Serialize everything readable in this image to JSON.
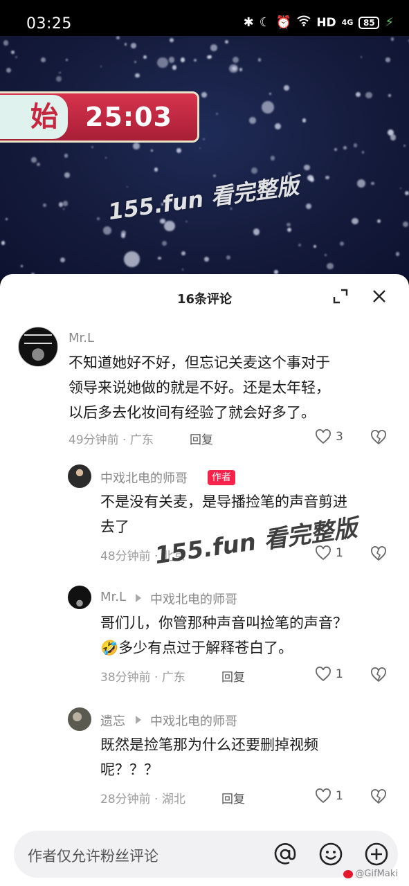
{
  "status_bar": {
    "time": "03:25",
    "bluetooth_icon": "bluetooth-icon",
    "dnd_icon": "moon-icon",
    "alarm_icon": "alarm-icon",
    "wifi_icon": "wifi-icon",
    "hd": "HD",
    "network": "4G",
    "battery": "85"
  },
  "video": {
    "banner_text": "始",
    "timer": "25:03",
    "watermark": "155.fun 看完整版"
  },
  "comments_panel": {
    "title": "16条评论",
    "expand_icon": "expand-icon",
    "close_icon": "close-icon",
    "reply_label": "回复",
    "author_badge": "作者"
  },
  "comments": [
    {
      "user": "Mr.L",
      "text_lines": [
        "不知道她好不好，但忘记关麦这个事对于",
        "领导来说她做的就是不好。还是太年轻，",
        "以后多去化妆间有经验了就会好多了。"
      ],
      "time_location": "49分钟前 · 广东",
      "likes": "3"
    },
    {
      "user": "中戏北电的师哥",
      "text_lines": [
        "不是没有关麦，是导播捡笔的声音剪进",
        "去了"
      ],
      "time_location": "48分钟前 · 北京",
      "likes": "1"
    },
    {
      "user": "Mr.L",
      "reply_to": "中戏北电的师哥",
      "text_lines": [
        "哥们儿，你管那种声音叫捡笔的声音？",
        "🤣多少有点过于解释苍白了。"
      ],
      "time_location": "38分钟前 · 广东",
      "likes": "1"
    },
    {
      "user": "遗忘",
      "reply_to": "中戏北电的师哥",
      "text_lines": [
        "既然是捡笔那为什么还要删掉视频",
        "呢？？？"
      ],
      "time_location": "28分钟前 · 湖北",
      "likes": "1"
    }
  ],
  "overlay_watermark": "155.fun 看完整版",
  "input_bar": {
    "placeholder": "作者仅允许粉丝评论",
    "at_icon": "at-icon",
    "emoji_icon": "emoji-icon",
    "add_icon": "add-icon"
  },
  "footer_watermark": "@GifMaki"
}
